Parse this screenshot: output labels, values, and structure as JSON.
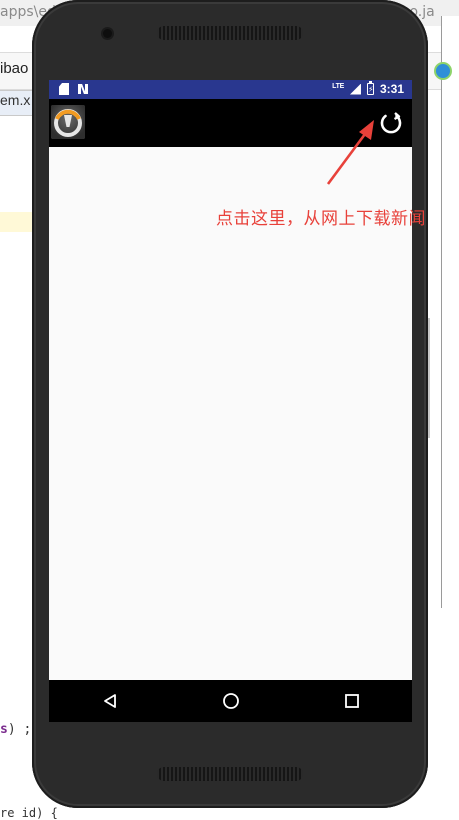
{
  "ide": {
    "path_left": "apps\\ed",
    "path_right": "bao.ja",
    "word": "ibao",
    "tab": "em.x",
    "code_line_1_prefix": "s",
    "code_line_1_suffix": ") ;",
    "code_line_2": "re id) {"
  },
  "statusbar": {
    "network": "LTE",
    "time": "3:31",
    "background_color": "#29378f"
  },
  "appbar": {
    "logo_icon": "overwatch-logo-icon",
    "refresh_icon": "refresh-icon",
    "background_color": "#000000"
  },
  "navbar": {
    "back_icon": "back-triangle-icon",
    "home_icon": "home-circle-icon",
    "recents_icon": "recents-square-icon"
  },
  "annotation": {
    "text": "点击这里，从网上下载新闻",
    "color": "#e8413a"
  }
}
